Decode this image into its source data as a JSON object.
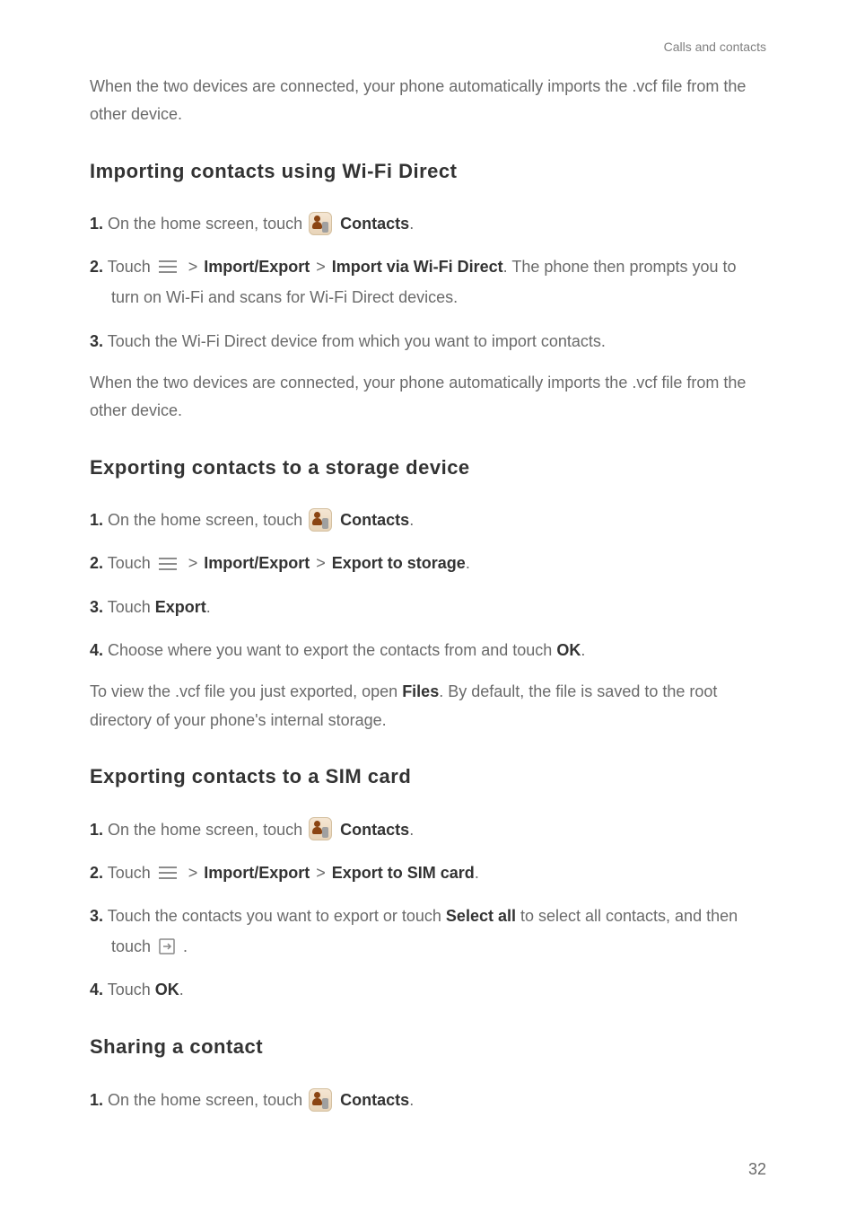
{
  "header": "Calls and contacts",
  "intro_para": "When the two devices are connected, your phone automatically imports the .vcf file from the other device.",
  "section1": {
    "title": "Importing contacts using Wi-Fi Direct",
    "step1_num": "1.",
    "step1_a": " On the home screen, touch ",
    "step1_b": "Contacts",
    "step1_c": ".",
    "step2_num": "2.",
    "step2_a": " Touch ",
    "step2_b": "Import/Export",
    "step2_c": "Import via Wi-Fi Direct",
    "step2_d": ". The phone then prompts you to turn on Wi-Fi and scans for Wi-Fi Direct devices.",
    "step3_num": "3.",
    "step3_a": " Touch the Wi-Fi Direct device from which you want to import contacts.",
    "closing": "When the two devices are connected, your phone automatically imports the .vcf file from the other device."
  },
  "section2": {
    "title": "Exporting contacts to a storage device",
    "step1_num": "1.",
    "step1_a": " On the home screen, touch ",
    "step1_b": "Contacts",
    "step1_c": ".",
    "step2_num": "2.",
    "step2_a": " Touch ",
    "step2_b": "Import/Export",
    "step2_c": "Export to storage",
    "step2_d": ".",
    "step3_num": "3.",
    "step3_a": " Touch ",
    "step3_b": "Export",
    "step3_c": ".",
    "step4_num": "4.",
    "step4_a": " Choose where you want to export the contacts from and touch ",
    "step4_b": "OK",
    "step4_c": ".",
    "closing_a": "To view the .vcf file you just exported, open ",
    "closing_b": "Files",
    "closing_c": ". By default, the file is saved to the root directory of your phone's internal storage."
  },
  "section3": {
    "title": "Exporting contacts to a SIM card",
    "step1_num": "1.",
    "step1_a": " On the home screen, touch ",
    "step1_b": "Contacts",
    "step1_c": ".",
    "step2_num": "2.",
    "step2_a": " Touch ",
    "step2_b": "Import/Export",
    "step2_c": "Export to SIM card",
    "step2_d": ".",
    "step3_num": "3.",
    "step3_a": " Touch the contacts you want to export or touch ",
    "step3_b": "Select all",
    "step3_c": " to select all contacts, and then touch ",
    "step3_d": " .",
    "step4_num": "4.",
    "step4_a": " Touch ",
    "step4_b": "OK",
    "step4_c": "."
  },
  "section4": {
    "title": "Sharing a contact",
    "step1_num": "1.",
    "step1_a": " On the home screen, touch ",
    "step1_b": "Contacts",
    "step1_c": "."
  },
  "gt_symbol": " > ",
  "page_number": "32"
}
